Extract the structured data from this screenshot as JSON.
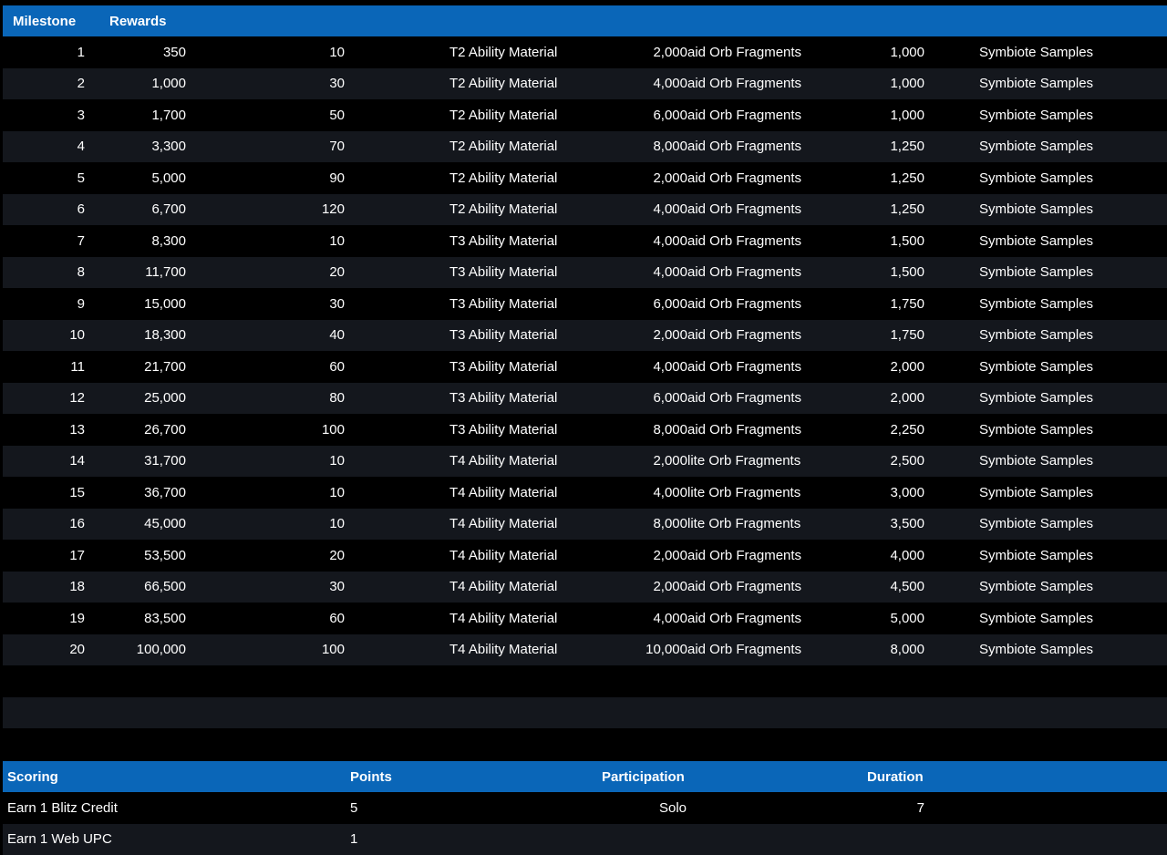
{
  "milestones_table": {
    "headers": {
      "milestone": "Milestone",
      "rewards": "Rewards"
    },
    "rows": [
      {
        "milestone": "1",
        "points": "350",
        "qty1": "10",
        "name1": "T2 Ability Material",
        "qty2": "2,000",
        "name2": "aid Orb Fragments",
        "qty3": "1,000",
        "name3": "Symbiote Samples"
      },
      {
        "milestone": "2",
        "points": "1,000",
        "qty1": "30",
        "name1": "T2 Ability Material",
        "qty2": "4,000",
        "name2": "aid Orb Fragments",
        "qty3": "1,000",
        "name3": "Symbiote Samples"
      },
      {
        "milestone": "3",
        "points": "1,700",
        "qty1": "50",
        "name1": "T2 Ability Material",
        "qty2": "6,000",
        "name2": "aid Orb Fragments",
        "qty3": "1,000",
        "name3": "Symbiote Samples"
      },
      {
        "milestone": "4",
        "points": "3,300",
        "qty1": "70",
        "name1": "T2 Ability Material",
        "qty2": "8,000",
        "name2": "aid Orb Fragments",
        "qty3": "1,250",
        "name3": "Symbiote Samples"
      },
      {
        "milestone": "5",
        "points": "5,000",
        "qty1": "90",
        "name1": "T2 Ability Material",
        "qty2": "2,000",
        "name2": "aid Orb Fragments",
        "qty3": "1,250",
        "name3": "Symbiote Samples"
      },
      {
        "milestone": "6",
        "points": "6,700",
        "qty1": "120",
        "name1": "T2 Ability Material",
        "qty2": "4,000",
        "name2": "aid Orb Fragments",
        "qty3": "1,250",
        "name3": "Symbiote Samples"
      },
      {
        "milestone": "7",
        "points": "8,300",
        "qty1": "10",
        "name1": "T3 Ability Material",
        "qty2": "4,000",
        "name2": "aid Orb Fragments",
        "qty3": "1,500",
        "name3": "Symbiote Samples"
      },
      {
        "milestone": "8",
        "points": "11,700",
        "qty1": "20",
        "name1": "T3 Ability Material",
        "qty2": "4,000",
        "name2": "aid Orb Fragments",
        "qty3": "1,500",
        "name3": "Symbiote Samples"
      },
      {
        "milestone": "9",
        "points": "15,000",
        "qty1": "30",
        "name1": "T3 Ability Material",
        "qty2": "6,000",
        "name2": "aid Orb Fragments",
        "qty3": "1,750",
        "name3": "Symbiote Samples"
      },
      {
        "milestone": "10",
        "points": "18,300",
        "qty1": "40",
        "name1": "T3 Ability Material",
        "qty2": "2,000",
        "name2": "aid Orb Fragments",
        "qty3": "1,750",
        "name3": "Symbiote Samples"
      },
      {
        "milestone": "11",
        "points": "21,700",
        "qty1": "60",
        "name1": "T3 Ability Material",
        "qty2": "4,000",
        "name2": "aid Orb Fragments",
        "qty3": "2,000",
        "name3": "Symbiote Samples"
      },
      {
        "milestone": "12",
        "points": "25,000",
        "qty1": "80",
        "name1": "T3 Ability Material",
        "qty2": "6,000",
        "name2": "aid Orb Fragments",
        "qty3": "2,000",
        "name3": "Symbiote Samples"
      },
      {
        "milestone": "13",
        "points": "26,700",
        "qty1": "100",
        "name1": "T3 Ability Material",
        "qty2": "8,000",
        "name2": "aid Orb Fragments",
        "qty3": "2,250",
        "name3": "Symbiote Samples"
      },
      {
        "milestone": "14",
        "points": "31,700",
        "qty1": "10",
        "name1": "T4 Ability Material",
        "qty2": "2,000",
        "name2": "lite Orb Fragments",
        "qty3": "2,500",
        "name3": "Symbiote Samples"
      },
      {
        "milestone": "15",
        "points": "36,700",
        "qty1": "10",
        "name1": "T4 Ability Material",
        "qty2": "4,000",
        "name2": "lite Orb Fragments",
        "qty3": "3,000",
        "name3": "Symbiote Samples"
      },
      {
        "milestone": "16",
        "points": "45,000",
        "qty1": "10",
        "name1": "T4 Ability Material",
        "qty2": "8,000",
        "name2": "lite Orb Fragments",
        "qty3": "3,500",
        "name3": "Symbiote Samples"
      },
      {
        "milestone": "17",
        "points": "53,500",
        "qty1": "20",
        "name1": "T4 Ability Material",
        "qty2": "2,000",
        "name2": "aid Orb Fragments",
        "qty3": "4,000",
        "name3": "Symbiote Samples"
      },
      {
        "milestone": "18",
        "points": "66,500",
        "qty1": "30",
        "name1": "T4 Ability Material",
        "qty2": "2,000",
        "name2": "aid Orb Fragments",
        "qty3": "4,500",
        "name3": "Symbiote Samples"
      },
      {
        "milestone": "19",
        "points": "83,500",
        "qty1": "60",
        "name1": "T4 Ability Material",
        "qty2": "4,000",
        "name2": "aid Orb Fragments",
        "qty3": "5,000",
        "name3": "Symbiote Samples"
      },
      {
        "milestone": "20",
        "points": "100,000",
        "qty1": "100",
        "name1": "T4 Ability Material",
        "qty2": "10,000",
        "name2": "aid Orb Fragments",
        "qty3": "8,000",
        "name3": "Symbiote Samples"
      }
    ]
  },
  "scoring_table": {
    "headers": {
      "scoring": "Scoring",
      "points": "Points",
      "participation": "Participation",
      "duration": "Duration"
    },
    "rows": [
      {
        "name": "Earn 1 Blitz Credit",
        "points": "5",
        "participation": "Solo",
        "duration": "7"
      },
      {
        "name": "Earn 1 Web UPC",
        "points": "1",
        "participation": "",
        "duration": ""
      }
    ]
  },
  "colors": {
    "header_blue": "#0a66b8",
    "row_dark": "#14171d",
    "row_black": "#000000"
  }
}
